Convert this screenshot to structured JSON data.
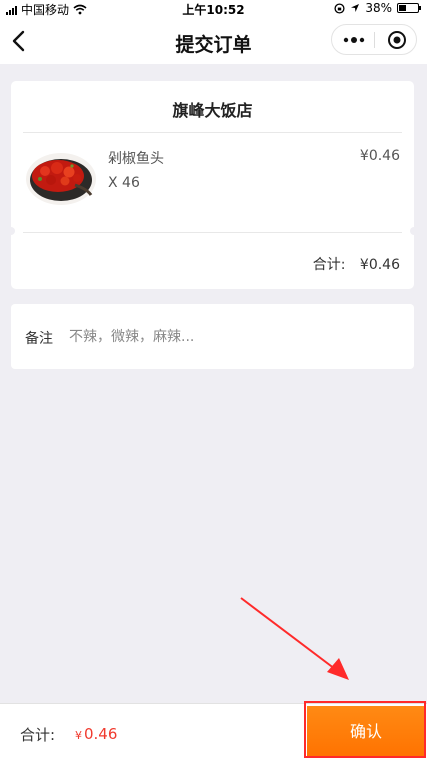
{
  "status_bar": {
    "carrier": "中国移动",
    "time": "上午10:52",
    "battery": "38%",
    "battery_level": 0.38
  },
  "nav": {
    "title": "提交订单"
  },
  "order": {
    "shop_name": "旗峰大饭店",
    "items": [
      {
        "name": "剁椒鱼头",
        "quantity": "X 46",
        "price": "¥0.46"
      }
    ],
    "total_label": "合计:",
    "total_amount": "¥0.46"
  },
  "remark": {
    "label": "备注",
    "placeholder": "不辣，微辣，麻辣..."
  },
  "bottom": {
    "total_label": "合计:",
    "currency": "¥",
    "total_value": "0.46",
    "confirm_label": "确认"
  },
  "colors": {
    "accent": "#ff7a0a",
    "price_red": "#f03a2e",
    "highlight": "#ff2a2a"
  }
}
